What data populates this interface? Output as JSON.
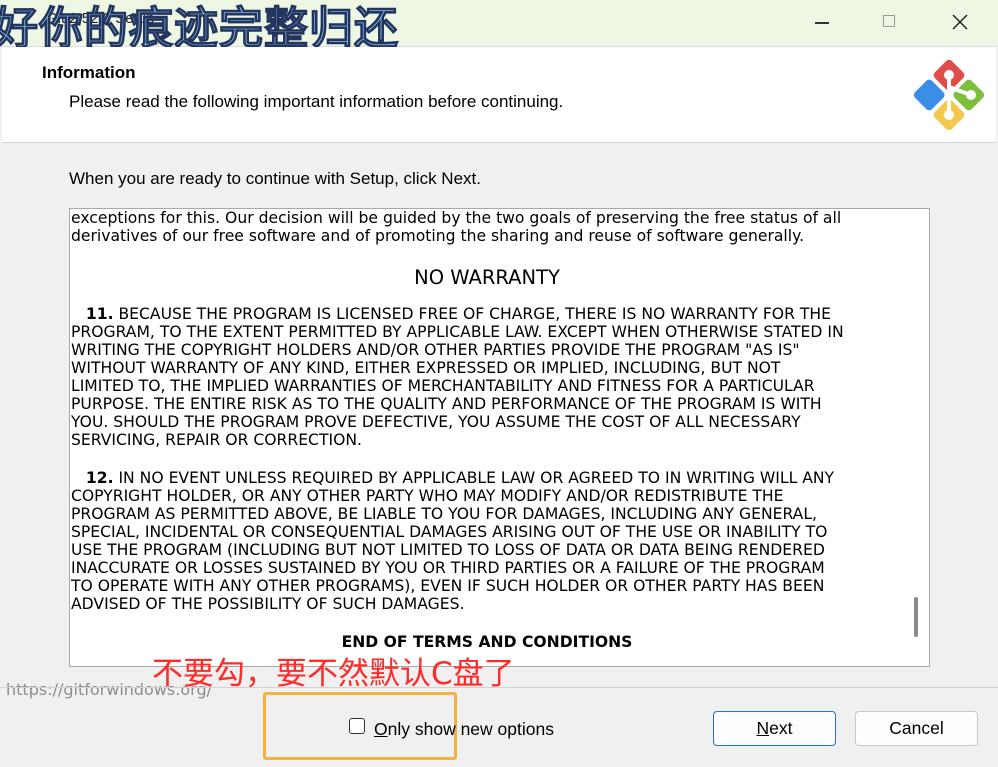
{
  "window": {
    "title": "Git 2.52.0 Setup",
    "watermark": "好你的痕迹完整归还",
    "minimize_icon": "minimize-icon",
    "maximize_icon": "maximize-icon",
    "close_icon": "close-icon"
  },
  "header": {
    "title": "Information",
    "subtitle": "Please read the following important information before continuing.",
    "logo_icon": "git-logo-icon"
  },
  "body": {
    "instruction": "When you are ready to continue with Setup, click Next."
  },
  "license": {
    "intro_lines": [
      "exceptions for this. Our decision will be guided by the two goals of preserving the free status of all",
      "derivatives of our free software and of promoting the sharing and reuse of software generally."
    ],
    "heading": "NO WARRANTY",
    "s11_num": "11.",
    "s11_first": " BECAUSE THE PROGRAM IS LICENSED FREE OF CHARGE, THERE IS NO WARRANTY FOR THE",
    "s11_lines": [
      "PROGRAM, TO THE EXTENT PERMITTED BY APPLICABLE LAW. EXCEPT WHEN OTHERWISE STATED IN",
      "WRITING THE COPYRIGHT HOLDERS AND/OR OTHER PARTIES PROVIDE THE PROGRAM \"AS IS\"",
      "WITHOUT WARRANTY OF ANY KIND, EITHER EXPRESSED OR IMPLIED, INCLUDING, BUT NOT",
      "LIMITED TO, THE IMPLIED WARRANTIES OF MERCHANTABILITY AND FITNESS FOR A PARTICULAR",
      "PURPOSE. THE ENTIRE RISK AS TO THE QUALITY AND PERFORMANCE OF THE PROGRAM IS WITH",
      "YOU. SHOULD THE PROGRAM PROVE DEFECTIVE, YOU ASSUME THE COST OF ALL NECESSARY",
      "SERVICING, REPAIR OR CORRECTION."
    ],
    "s12_num": "12.",
    "s12_first": " IN NO EVENT UNLESS REQUIRED BY APPLICABLE LAW OR AGREED TO IN WRITING WILL ANY",
    "s12_lines": [
      "COPYRIGHT HOLDER, OR ANY OTHER PARTY WHO MAY MODIFY AND/OR REDISTRIBUTE THE",
      "PROGRAM AS PERMITTED ABOVE, BE LIABLE TO YOU FOR DAMAGES, INCLUDING ANY GENERAL,",
      "SPECIAL, INCIDENTAL OR CONSEQUENTIAL DAMAGES ARISING OUT OF THE USE OR INABILITY TO",
      "USE THE PROGRAM (INCLUDING BUT NOT LIMITED TO LOSS OF DATA OR DATA BEING RENDERED",
      "INACCURATE OR LOSSES SUSTAINED BY YOU OR THIRD PARTIES OR A FAILURE OF THE PROGRAM",
      "TO OPERATE WITH ANY OTHER PROGRAMS), EVEN IF SUCH HOLDER OR OTHER PARTY HAS BEEN",
      "ADVISED OF THE POSSIBILITY OF SUCH DAMAGES."
    ],
    "end": "END OF TERMS AND CONDITIONS"
  },
  "footer": {
    "url": "https://gitforwindows.org/",
    "annotation": "不要勾，要不然默认C盘了",
    "checkbox_label_underlined": "O",
    "checkbox_label_rest": "nly show new options",
    "checkbox_checked": false,
    "next_underlined": "N",
    "next_rest": "ext",
    "cancel_label": "Cancel",
    "highlight_color": "#f5b23a",
    "annotation_color": "#ff2a2a",
    "next_border_color": "#2a6fc9"
  }
}
